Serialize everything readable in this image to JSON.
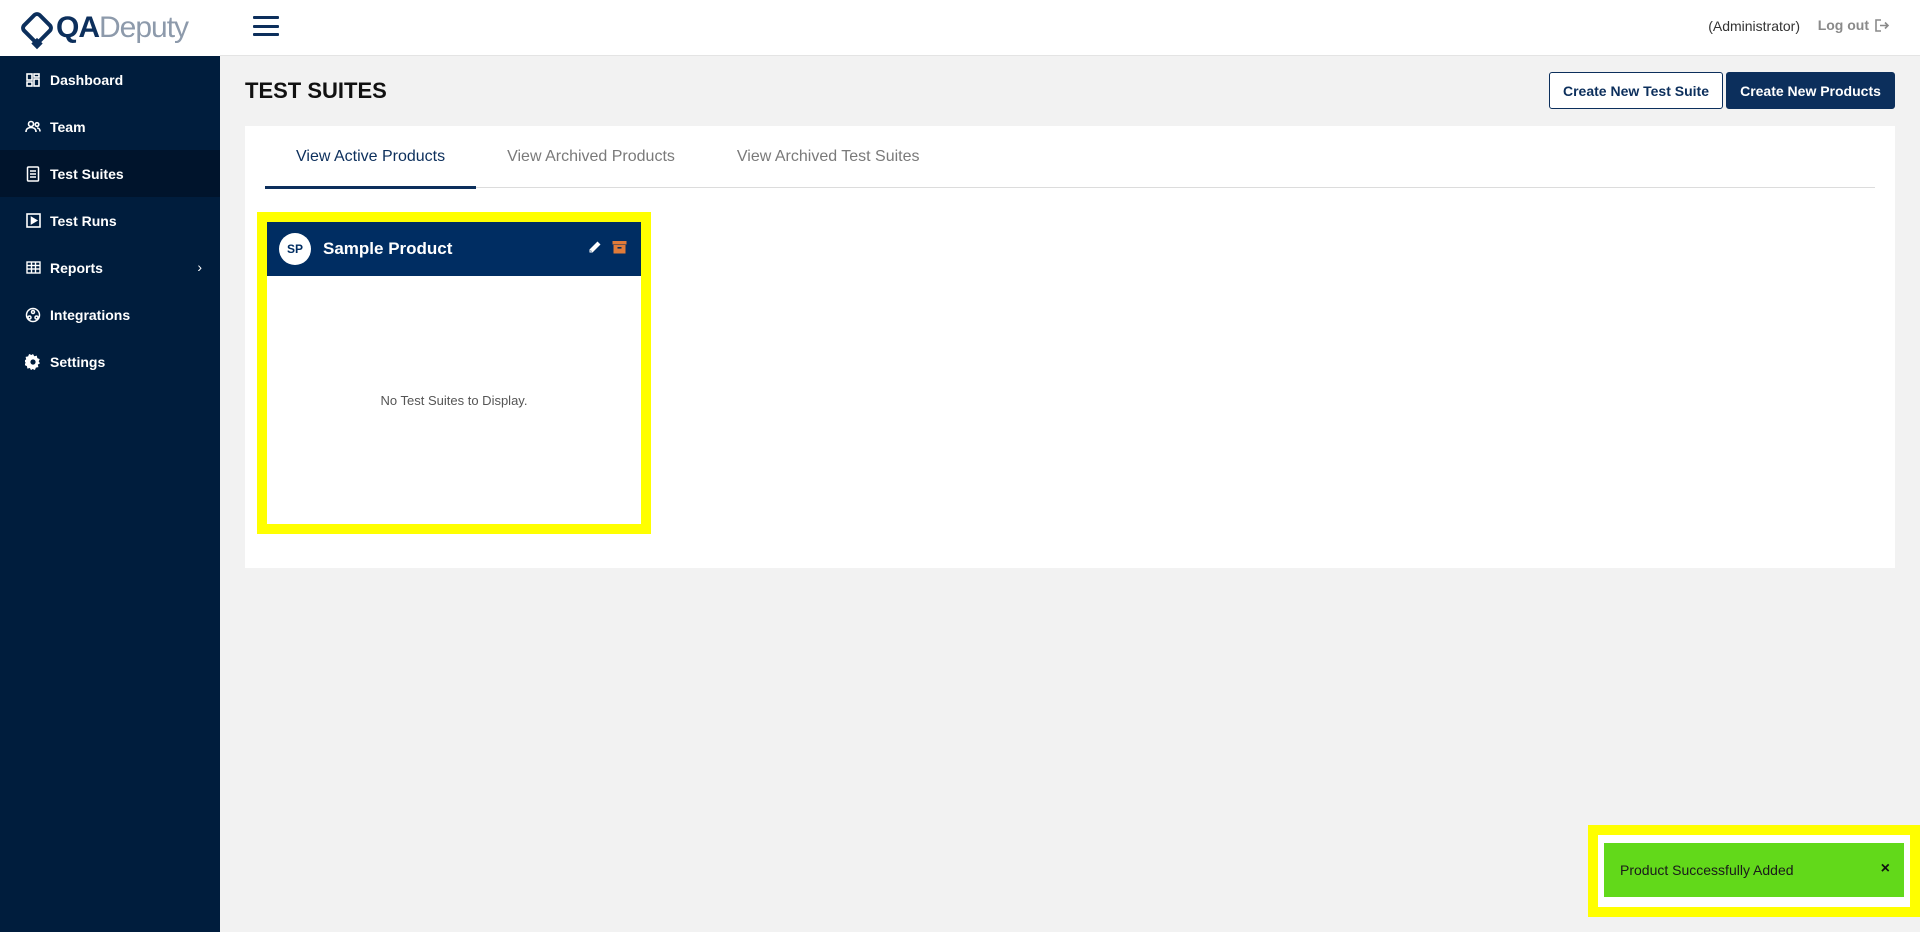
{
  "brand": {
    "qa": "QA",
    "deputy": "Deputy"
  },
  "sidebar": {
    "items": [
      {
        "label": "Dashboard",
        "icon": "dashboard-icon"
      },
      {
        "label": "Team",
        "icon": "team-icon"
      },
      {
        "label": "Test Suites",
        "icon": "test-suites-icon",
        "active": true
      },
      {
        "label": "Test Runs",
        "icon": "play-icon"
      },
      {
        "label": "Reports",
        "icon": "table-icon",
        "has_submenu": true,
        "chevron": "›"
      },
      {
        "label": "Integrations",
        "icon": "integrations-icon"
      },
      {
        "label": "Settings",
        "icon": "gear-icon"
      }
    ]
  },
  "header": {
    "user_role": "(Administrator)",
    "logout_label": "Log out"
  },
  "main": {
    "title": "TEST SUITES",
    "buttons": {
      "create_suite": "Create New Test Suite",
      "create_products": "Create New Products"
    },
    "tabs": [
      {
        "label": "View Active Products",
        "active": true
      },
      {
        "label": "View Archived Products"
      },
      {
        "label": "View Archived Test Suites"
      }
    ],
    "product_card": {
      "initials": "SP",
      "name": "Sample Product",
      "empty_text": "No Test Suites to Display."
    }
  },
  "toast": {
    "message": "Product Successfully Added",
    "close": "×"
  },
  "colors": {
    "sidebar_bg": "#001d3d",
    "primary": "#0c2f5c",
    "card_header": "#002d62",
    "toast_bg": "#62d91a",
    "highlight": "#ffff00",
    "archive_icon": "#e07b39"
  }
}
